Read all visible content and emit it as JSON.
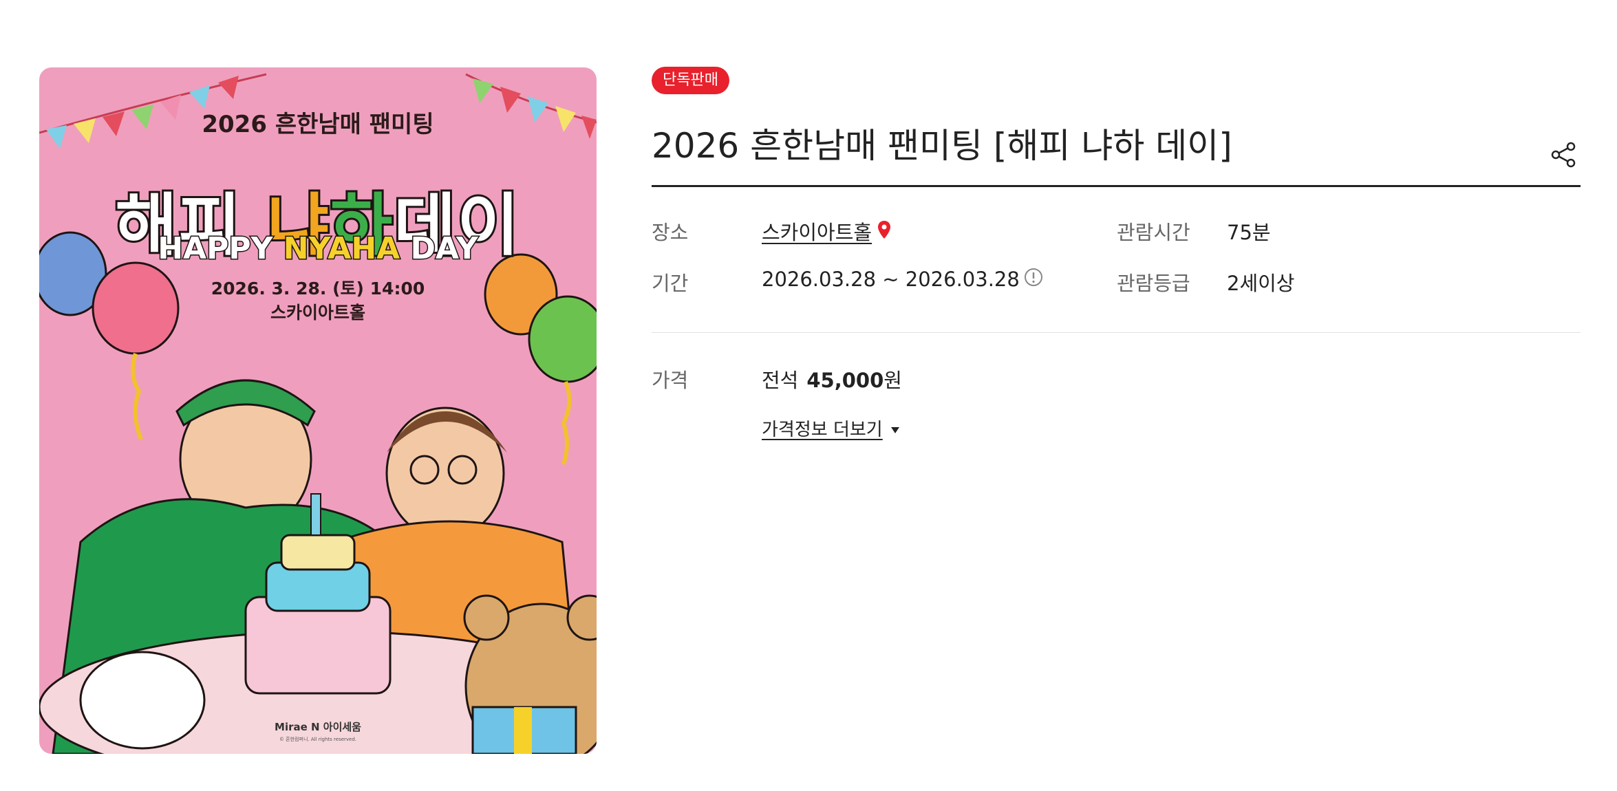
{
  "poster": {
    "alt_title_line": "2026 흔한남매 팬미팅",
    "main_title_parts": [
      "해피",
      "냐",
      "하",
      "데이"
    ],
    "english_parts": [
      "HAPPY",
      "NYAHA",
      "DAY"
    ],
    "date_line": "2026. 3. 28. (토) 14:00",
    "venue_line": "스카이아트홀",
    "credit": "Mirae N 아이세움",
    "copyright": "© 흔한컴퍼니. All rights reserved."
  },
  "badge": "단독판매",
  "title": "2026 흔한남매 팬미팅 [해피 냐하 데이]",
  "info": {
    "venue_label": "장소",
    "venue_value": "스카이아트홀",
    "period_label": "기간",
    "period_value": "2026.03.28 ~ 2026.03.28",
    "runtime_label": "관람시간",
    "runtime_value": "75분",
    "rating_label": "관람등급",
    "rating_value": "2세이상"
  },
  "price": {
    "label": "가격",
    "seat": "전석",
    "amount": "45,000",
    "unit": "원",
    "more_link": "가격정보 더보기"
  },
  "colors": {
    "badge": "#e8212c",
    "pin": "#e8212c",
    "poster_bg": "#ef9fbd"
  },
  "icons": [
    "share-icon",
    "location-pin-icon",
    "info-circle-icon",
    "caret-down-icon"
  ]
}
